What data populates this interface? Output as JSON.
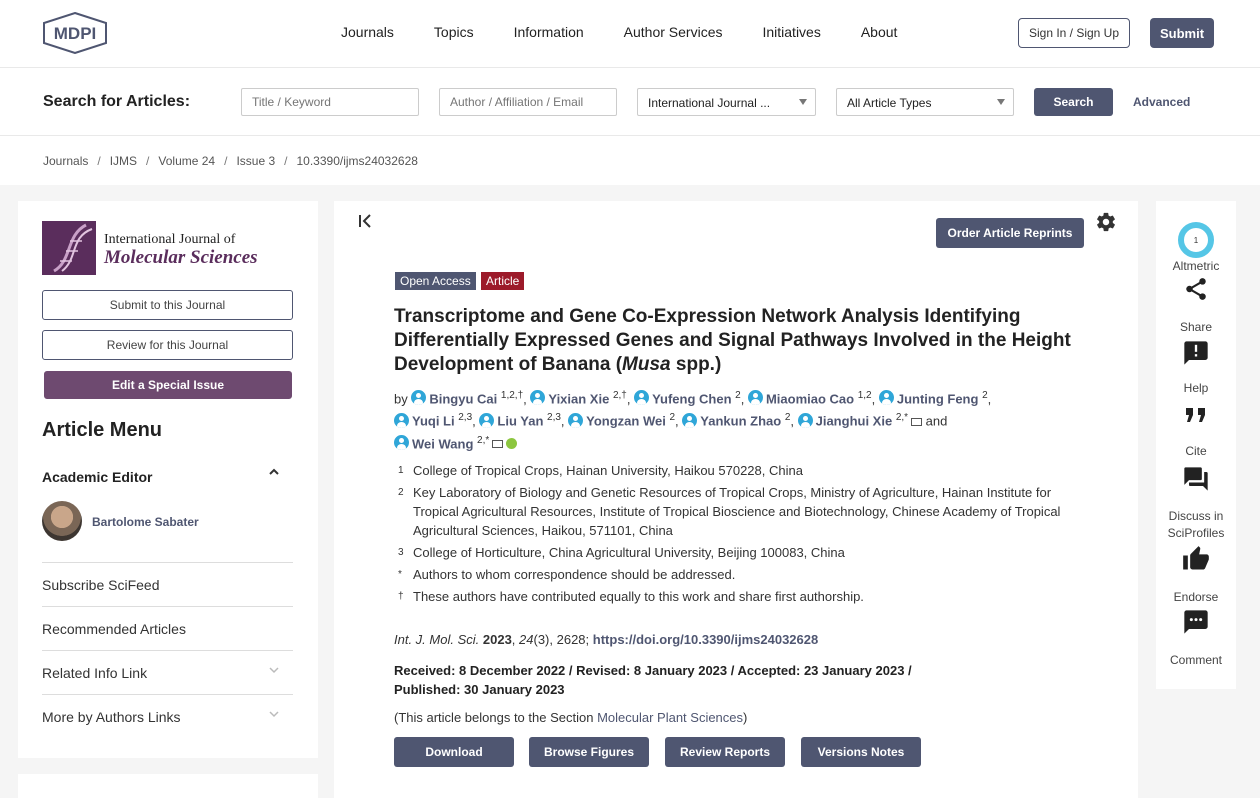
{
  "brand": {
    "logo_text": "MDPI"
  },
  "nav": {
    "items": [
      "Journals",
      "Topics",
      "Information",
      "Author Services",
      "Initiatives",
      "About"
    ],
    "sign_in": "Sign In / Sign Up",
    "submit": "Submit"
  },
  "search": {
    "label": "Search for Articles:",
    "keyword_placeholder": "Title / Keyword",
    "author_placeholder": "Author / Affiliation / Email",
    "journal_value": "International Journal ...",
    "type_value": "All Article Types",
    "button": "Search",
    "advanced": "Advanced"
  },
  "breadcrumb": [
    "Journals",
    "IJMS",
    "Volume 24",
    "Issue 3",
    "10.3390/ijms24032628"
  ],
  "sidebar": {
    "journal_name_line1": "International Journal of",
    "journal_name_line2": "Molecular Sciences",
    "submit_btn": "Submit to this Journal",
    "review_btn": "Review for this Journal",
    "special_btn": "Edit a Special Issue",
    "menu_title": "Article Menu",
    "academic_editor_label": "Academic Editor",
    "editor_name": "Bartolome Sabater",
    "menu_items": [
      "Subscribe SciFeed",
      "Recommended Articles",
      "Related Info Link",
      "More by Authors Links"
    ]
  },
  "article": {
    "reprints_btn": "Order Article Reprints",
    "tag_open_access": "Open Access",
    "tag_type": "Article",
    "title_main": "Transcriptome and Gene Co-Expression Network Analysis Identifying Differentially Expressed Genes and Signal Pathways Involved in the Height Development of Banana (",
    "title_italic": "Musa",
    "title_end": " spp.)",
    "by": "by",
    "authors": [
      {
        "name": "Bingyu Cai",
        "sup": "1,2,†"
      },
      {
        "name": "Yixian Xie",
        "sup": "2,†"
      },
      {
        "name": "Yufeng Chen",
        "sup": "2"
      },
      {
        "name": "Miaomiao Cao",
        "sup": "1,2"
      },
      {
        "name": "Junting Feng",
        "sup": "2"
      },
      {
        "name": "Yuqi Li",
        "sup": "2,3"
      },
      {
        "name": "Liu Yan",
        "sup": "2,3"
      },
      {
        "name": "Yongzan Wei",
        "sup": "2"
      },
      {
        "name": "Yankun Zhao",
        "sup": "2"
      },
      {
        "name": "Jianghui Xie",
        "sup": "2,*"
      },
      {
        "name": "Wei Wang",
        "sup": "2,*"
      }
    ],
    "and": "and",
    "affiliations": [
      {
        "num": "1",
        "text": "College of Tropical Crops, Hainan University, Haikou 570228, China"
      },
      {
        "num": "2",
        "text": "Key Laboratory of Biology and Genetic Resources of Tropical Crops, Ministry of Agriculture, Hainan Institute for Tropical Agricultural Resources, Institute of Tropical Bioscience and Biotechnology, Chinese Academy of Tropical Agricultural Sciences, Haikou, 571101, China"
      },
      {
        "num": "3",
        "text": "College of Horticulture, China Agricultural University, Beijing 100083, China"
      },
      {
        "num": "*",
        "text": "Authors to whom correspondence should be addressed."
      },
      {
        "num": "†",
        "text": "These authors have contributed equally to this work and share first authorship."
      }
    ],
    "citation_journal": "Int. J. Mol. Sci.",
    "citation_year": "2023",
    "citation_volume": "24",
    "citation_rest": "(3), 2628;",
    "citation_doi": "https://doi.org/10.3390/ijms24032628",
    "dates_line1": "Received: 8 December 2022 / Revised: 8 January 2023 / Accepted: 23 January 2023 /",
    "dates_line2": "Published: 30 January 2023",
    "section_prefix": "(This article belongs to the Section ",
    "section_name": "Molecular Plant Sciences",
    "section_suffix": ")",
    "buttons": [
      "Download",
      "Browse Figures",
      "Review Reports",
      "Versions Notes"
    ]
  },
  "right": {
    "altmetric_score": "1",
    "labels": [
      "Altmetric",
      "Share",
      "Help",
      "Cite",
      "Discuss in SciProfiles",
      "Endorse",
      "Comment"
    ]
  },
  "colors": {
    "primary": "#4f5671",
    "special": "#6e4a70",
    "article_tag": "#9c1a2a",
    "author_icon": "#2fa6d8"
  }
}
